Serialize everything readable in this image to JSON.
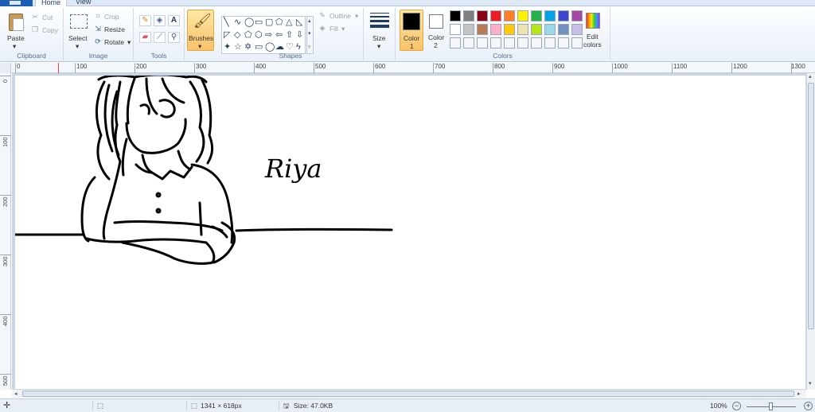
{
  "tabs": [
    {
      "label": "Home",
      "active": true
    },
    {
      "label": "View",
      "active": false
    }
  ],
  "ribbon": {
    "clipboard": {
      "paste_label": "Paste",
      "cut_label": "Cut",
      "copy_label": "Copy",
      "group_label": "Clipboard"
    },
    "image": {
      "select_label": "Select",
      "crop_label": "Crop",
      "resize_label": "Resize",
      "rotate_label": "Rotate",
      "group_label": "Image"
    },
    "tools": {
      "group_label": "Tools",
      "items": [
        "pencil-icon",
        "fill-icon",
        "text-icon",
        "eraser-icon",
        "color-picker-icon",
        "magnifier-icon"
      ]
    },
    "brushes": {
      "label": "Brushes"
    },
    "shapes": {
      "outline_label": "Outline",
      "fill_label": "Fill",
      "group_label": "Shapes"
    },
    "size": {
      "label": "Size"
    },
    "colors": {
      "color1_label": "Color",
      "color1_num": "1",
      "color2_label": "Color",
      "color2_num": "2",
      "color1_value": "#000000",
      "color2_value": "#ffffff",
      "edit_label_1": "Edit",
      "edit_label_2": "colors",
      "group_label": "Colors",
      "palette_row1": [
        "#000000",
        "#7f7f7f",
        "#880015",
        "#ed1c24",
        "#ff7f27",
        "#fff200",
        "#22b14c",
        "#00a2e8",
        "#3f48cc",
        "#a349a4"
      ],
      "palette_row2": [
        "#ffffff",
        "#c3c3c3",
        "#b97a57",
        "#ffaec9",
        "#ffc90e",
        "#efe4b0",
        "#b5e61d",
        "#99d9ea",
        "#7092be",
        "#c8bfe7"
      ]
    }
  },
  "rulers": {
    "horizontal": [
      "0",
      "100",
      "200",
      "300",
      "400",
      "500",
      "600",
      "700",
      "800",
      "900",
      "1000",
      "1100",
      "1200",
      "1300"
    ],
    "vertical": [
      "0",
      "100",
      "200",
      "300",
      "400",
      "500"
    ]
  },
  "canvas": {
    "drawn_text": "Riya"
  },
  "status": {
    "dimensions": "1341 × 618px",
    "size": "Size: 47.0KB",
    "zoom": "100%"
  }
}
